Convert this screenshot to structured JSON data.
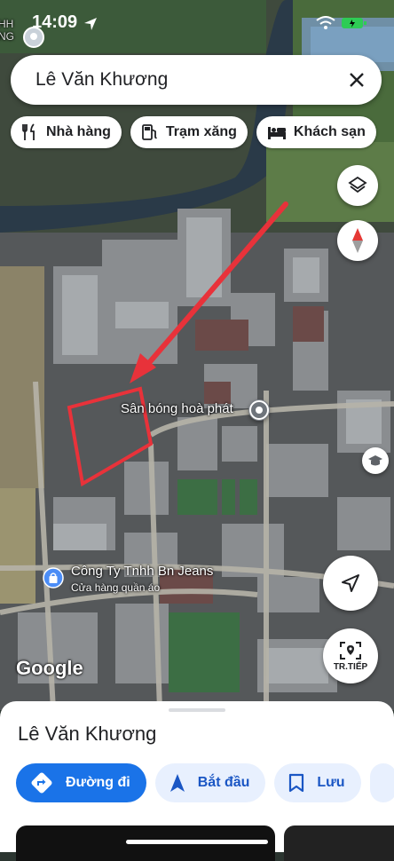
{
  "status_bar": {
    "time": "14:09"
  },
  "search": {
    "query": "Lê Văn Khương"
  },
  "chips": [
    {
      "icon": "restaurant-icon",
      "label": "Nhà hàng"
    },
    {
      "icon": "gas-station-icon",
      "label": "Trạm xăng"
    },
    {
      "icon": "hotel-icon",
      "label": "Khách sạn"
    }
  ],
  "map": {
    "faded_label": "HH\nNG",
    "poi_sports": "Sân bóng hoà phát",
    "poi_company_name": "Công Ty Tnhh Bn Jeans",
    "poi_company_category": "Cửa hàng quần áo",
    "attribution": "Google",
    "streetview_label": "TR.TIẾP",
    "annotation_color": "#e8323a"
  },
  "sheet": {
    "title": "Lê Văn Khương",
    "actions": [
      {
        "icon": "directions-icon",
        "label": "Đường đi"
      },
      {
        "icon": "navigation-start-icon",
        "label": "Bắt đầu"
      },
      {
        "icon": "bookmark-icon",
        "label": "Lưu"
      }
    ]
  },
  "colors": {
    "accent": "#1a73e8",
    "accent_light": "#e8f0fe",
    "poi_blue": "#4c8df6"
  }
}
